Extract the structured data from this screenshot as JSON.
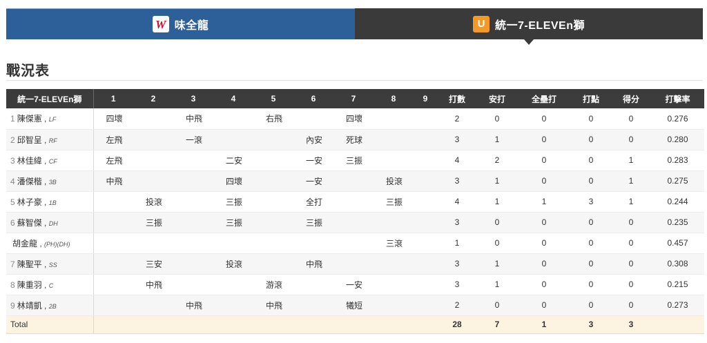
{
  "tabs": {
    "home": {
      "name": "味全龍",
      "logo": "W"
    },
    "away": {
      "name": "統一7-ELEVEn獅",
      "logo": "U"
    }
  },
  "section_title": "戰況表",
  "table": {
    "team_header": "統一7-ELEVEn獅",
    "innings": [
      "1",
      "2",
      "3",
      "4",
      "5",
      "6",
      "7",
      "8",
      "9"
    ],
    "stat_headers": [
      "打數",
      "安打",
      "全壘打",
      "打點",
      "得分",
      "打擊率"
    ],
    "rows": [
      {
        "order": "1",
        "name": "陳傑憲",
        "pos": "LF",
        "inn": [
          "四壞",
          "",
          "中飛",
          "",
          "右飛",
          "",
          "四壞",
          "",
          ""
        ],
        "stats": [
          "2",
          "0",
          "0",
          "0",
          "0",
          "0.276"
        ]
      },
      {
        "order": "2",
        "name": "邱智呈",
        "pos": "RF",
        "inn": [
          "左飛",
          "",
          "一滾",
          "",
          "",
          "內安",
          "死球",
          "",
          ""
        ],
        "stats": [
          "3",
          "1",
          "0",
          "0",
          "0",
          "0.280"
        ]
      },
      {
        "order": "3",
        "name": "林佳緯",
        "pos": "CF",
        "inn": [
          "左飛",
          "",
          "",
          "二安",
          "",
          "一安",
          "三振",
          "",
          ""
        ],
        "stats": [
          "4",
          "2",
          "0",
          "0",
          "1",
          "0.283"
        ]
      },
      {
        "order": "4",
        "name": "潘傑楷",
        "pos": "3B",
        "inn": [
          "中飛",
          "",
          "",
          "四壞",
          "",
          "一安",
          "",
          "投滾",
          ""
        ],
        "stats": [
          "3",
          "1",
          "0",
          "0",
          "1",
          "0.275"
        ]
      },
      {
        "order": "5",
        "name": "林子豪",
        "pos": "1B",
        "inn": [
          "",
          "投滾",
          "",
          "三振",
          "",
          "全打",
          "",
          "三振",
          ""
        ],
        "stats": [
          "4",
          "1",
          "1",
          "3",
          "1",
          "0.244"
        ]
      },
      {
        "order": "6",
        "name": "蘇智傑",
        "pos": "DH",
        "inn": [
          "",
          "三振",
          "",
          "三振",
          "",
          "三振",
          "",
          "",
          ""
        ],
        "stats": [
          "3",
          "0",
          "0",
          "0",
          "0",
          "0.235"
        ]
      },
      {
        "order": "",
        "name": "胡金龍",
        "pos": "(PH)(DH)",
        "inn": [
          "",
          "",
          "",
          "",
          "",
          "",
          "",
          "三滾",
          ""
        ],
        "stats": [
          "1",
          "0",
          "0",
          "0",
          "0",
          "0.457"
        ]
      },
      {
        "order": "7",
        "name": "陳聖平",
        "pos": "SS",
        "inn": [
          "",
          "三安",
          "",
          "投滾",
          "",
          "中飛",
          "",
          "",
          ""
        ],
        "stats": [
          "3",
          "1",
          "0",
          "0",
          "0",
          "0.308"
        ]
      },
      {
        "order": "8",
        "name": "陳重羽",
        "pos": "C",
        "inn": [
          "",
          "中飛",
          "",
          "",
          "游滾",
          "",
          "一安",
          "",
          ""
        ],
        "stats": [
          "3",
          "1",
          "0",
          "0",
          "0",
          "0.215"
        ]
      },
      {
        "order": "9",
        "name": "林靖凱",
        "pos": "2B",
        "inn": [
          "",
          "",
          "中飛",
          "",
          "中飛",
          "",
          "犧短",
          "",
          ""
        ],
        "stats": [
          "2",
          "0",
          "0",
          "0",
          "0",
          "0.273"
        ]
      }
    ],
    "total": {
      "label": "Total",
      "stats": [
        "28",
        "7",
        "1",
        "3",
        "3",
        ""
      ]
    }
  }
}
